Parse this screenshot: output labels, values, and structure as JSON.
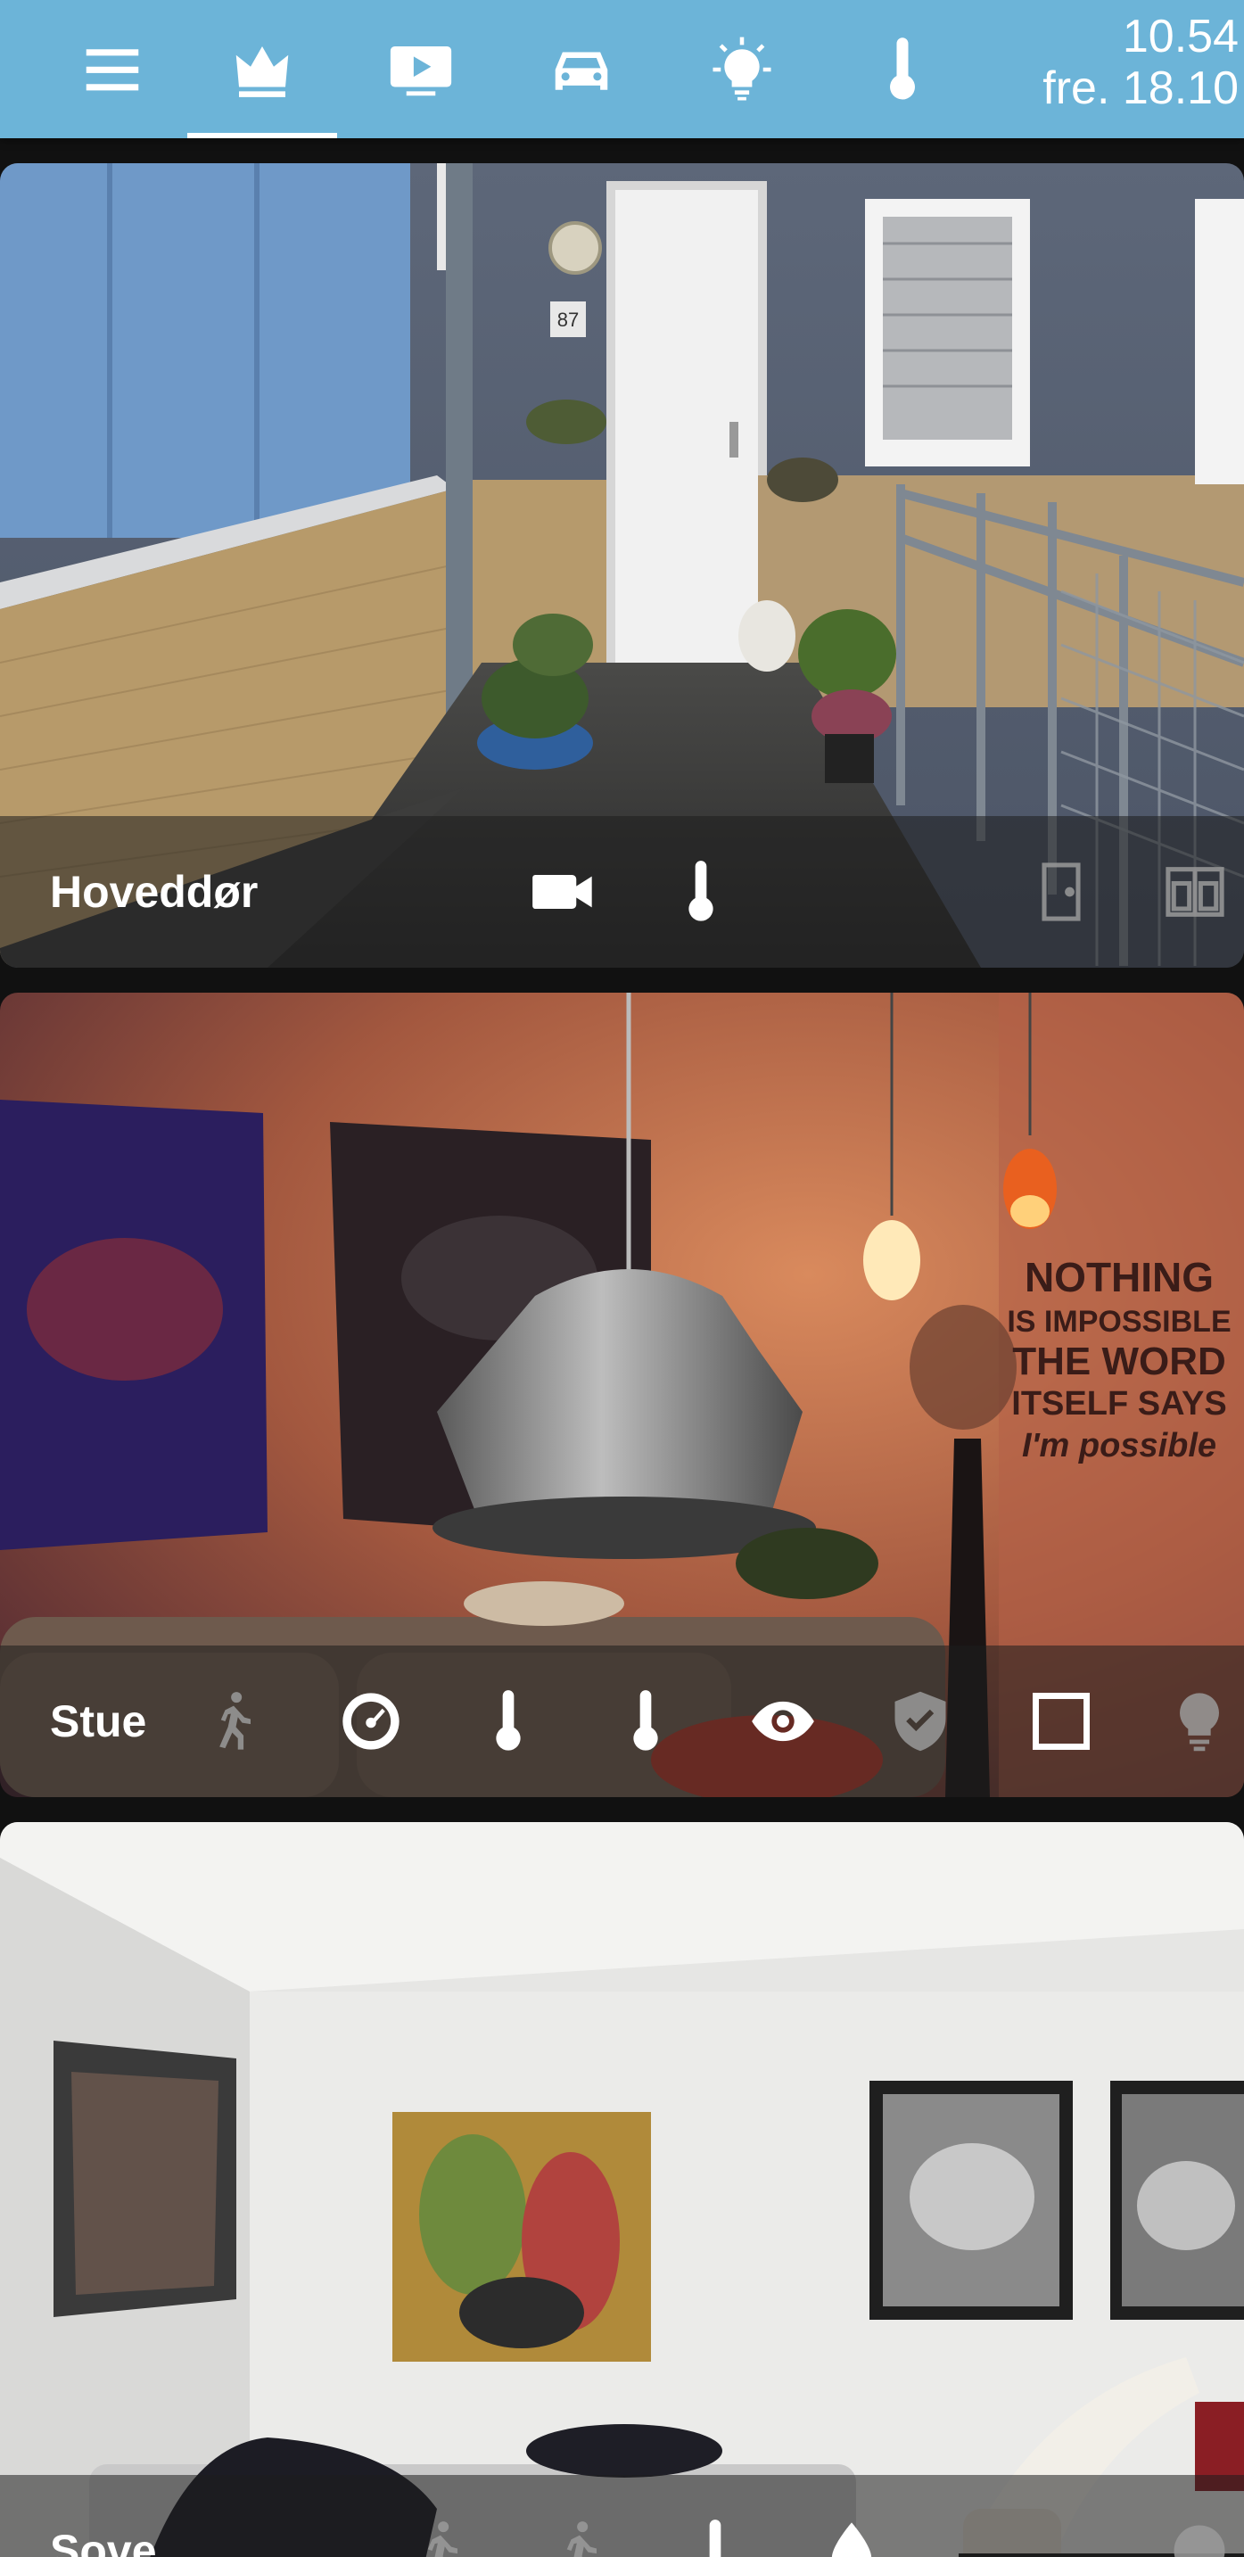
{
  "header": {
    "tabs": [
      {
        "icon": "menu-icon",
        "active": false
      },
      {
        "icon": "crown-icon",
        "active": true
      },
      {
        "icon": "media-play-icon",
        "active": false
      },
      {
        "icon": "car-icon",
        "active": false
      },
      {
        "icon": "lightbulb-icon",
        "active": false
      },
      {
        "icon": "thermometer-icon",
        "active": false
      }
    ],
    "time": "10.54",
    "date": "fre. 18.10",
    "background_color": "#6cb4d8"
  },
  "cards": [
    {
      "title": "Hoveddør",
      "icons": [
        "camera-icon",
        "thermometer-icon",
        "door-icon",
        "window-icon"
      ]
    },
    {
      "title": "Stue",
      "icons": [
        "motion-icon",
        "gauge-icon",
        "thermometer-icon",
        "thermometer-icon",
        "eye-icon",
        "shield-check-icon",
        "window-square-icon",
        "lightbulb-icon"
      ]
    },
    {
      "title": "Sove",
      "icons": [
        "motion-icon",
        "motion-icon",
        "thermometer-icon",
        "water-drop-icon",
        "circle-icon"
      ]
    }
  ],
  "picture_text": {
    "house_number": "87",
    "wall_quote": [
      "NOTHING",
      "IS IMPOSSIBLE",
      "THE WORD",
      "ITSELF SAYS",
      "I'm possible"
    ]
  }
}
